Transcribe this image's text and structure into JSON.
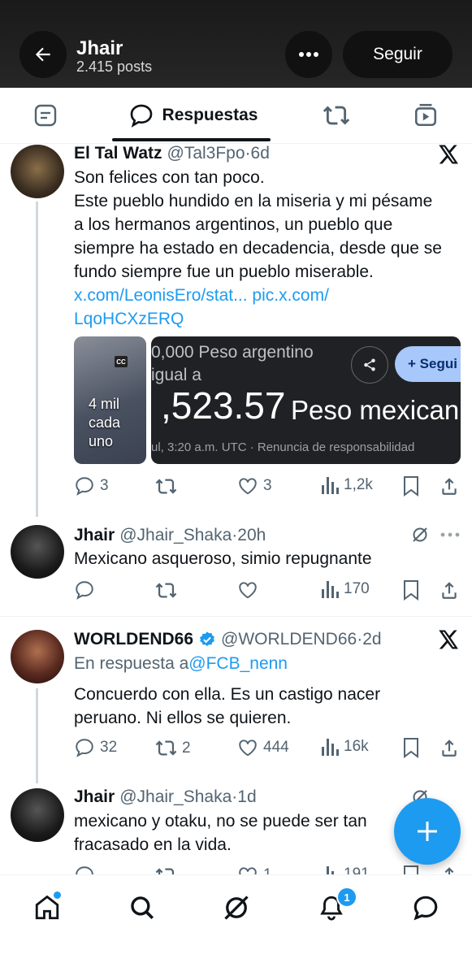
{
  "header": {
    "name": "Jhair",
    "posts": "2.415 posts",
    "follow_label": "Seguir"
  },
  "tabs": {
    "active_label": "Respuestas"
  },
  "posts": [
    {
      "name": "El Tal Watz",
      "handle": "@Tal3Fpo",
      "time": "6d",
      "lines": [
        "Son felices con tan poco.",
        "Este pueblo hundido en la miseria y mi pésame",
        "a los hermanos argentinos, un pueblo que",
        "siempre ha estado en decadencia, desde que se",
        "fundo siempre fue un pueblo miserable."
      ],
      "link_line1": "x.com/LeonisEro/stat... pic.x.com/",
      "link_line2": "LqoHCXzERQ",
      "media1": {
        "cc": "CC",
        "caption": [
          "4 mil",
          "cada",
          "uno"
        ]
      },
      "media2": {
        "line1": "0,000 Peso argentino",
        "line2": "igual a",
        "amount": ",523.57",
        "currency": "Peso mexican",
        "footer": "ul, 3:20 a.m. UTC · Renuncia de responsabilidad",
        "follow_chip": "+ Segui"
      },
      "stats": {
        "replies": "3",
        "reposts": "",
        "likes": "3",
        "views": "1,2k"
      }
    },
    {
      "name": "Jhair",
      "handle": "@Jhair_Shaka",
      "time": "20h",
      "lines": [
        "Mexicano asqueroso, simio repugnante"
      ],
      "stats": {
        "replies": "",
        "reposts": "",
        "likes": "",
        "views": "170"
      }
    },
    {
      "name": "WORLDEND66",
      "handle": "@WORLDEND66",
      "time": "2d",
      "reply_prefix": "En respuesta a ",
      "reply_to": "@FCB_nenn",
      "lines": [
        "Concuerdo con ella. Es un castigo nacer",
        "peruano. Ni ellos se quieren."
      ],
      "stats": {
        "replies": "32",
        "reposts": "2",
        "likes": "444",
        "views": "16k"
      }
    },
    {
      "name": "Jhair",
      "handle": "@Jhair_Shaka",
      "time": "1d",
      "lines": [
        "mexicano y otaku, no se puede ser tan",
        "fracasado en la vida."
      ],
      "stats": {
        "replies": "",
        "reposts": "",
        "likes": "1",
        "views": "191"
      }
    }
  ],
  "nav": {
    "notifications_badge": "1"
  },
  "colors": {
    "accent": "#1d9bf0",
    "header_bg": "#1f1f1f",
    "text": "#0f1419",
    "secondary": "#536471"
  }
}
